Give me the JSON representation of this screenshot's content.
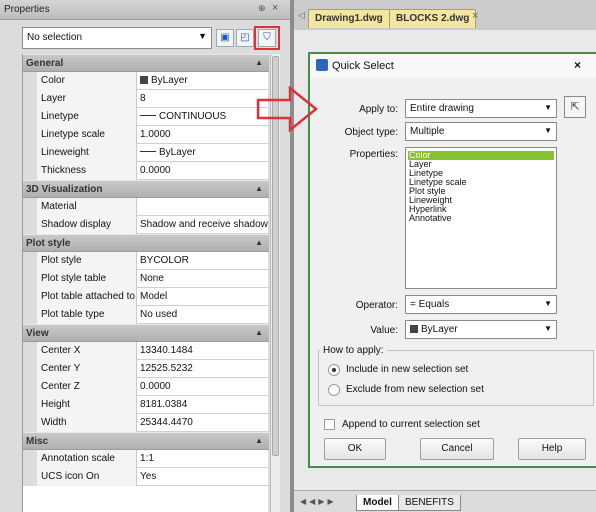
{
  "properties_palette": {
    "title": "Properties",
    "pin_glyph": "⊕",
    "close_glyph": "×",
    "selection": "No selection",
    "toolbar_icons": [
      "toggle-pickadd-icon",
      "select-objects-icon",
      "quick-select-icon"
    ],
    "categories": [
      {
        "name": "General",
        "rows": [
          {
            "name": "Color",
            "value": "ByLayer"
          },
          {
            "name": "Layer",
            "value": "8"
          },
          {
            "name": "Linetype",
            "value": "CONTINUOUS"
          },
          {
            "name": "Linetype scale",
            "value": "1.0000"
          },
          {
            "name": "Lineweight",
            "value": "ByLayer"
          },
          {
            "name": "Thickness",
            "value": "0.0000"
          }
        ]
      },
      {
        "name": "3D Visualization",
        "rows": [
          {
            "name": "Material",
            "value": ""
          },
          {
            "name": "Shadow display",
            "value": "Shadow and receive shadow"
          }
        ]
      },
      {
        "name": "Plot style",
        "rows": [
          {
            "name": "Plot style",
            "value": "BYCOLOR"
          },
          {
            "name": "Plot style table",
            "value": "None"
          },
          {
            "name": "Plot table attached to",
            "value": "Model"
          },
          {
            "name": "Plot table type",
            "value": "No used"
          }
        ]
      },
      {
        "name": "View",
        "rows": [
          {
            "name": "Center X",
            "value": "13340.1484"
          },
          {
            "name": "Center Y",
            "value": "12525.5232"
          },
          {
            "name": "Center Z",
            "value": "0.0000"
          },
          {
            "name": "Height",
            "value": "8181.0384"
          },
          {
            "name": "Width",
            "value": "25344.4470"
          }
        ]
      },
      {
        "name": "Misc",
        "rows": [
          {
            "name": "Annotation scale",
            "value": "1:1"
          },
          {
            "name": "UCS icon On",
            "value": "Yes"
          }
        ]
      }
    ]
  },
  "drawing": {
    "tabs": [
      "Drawing1.dwg",
      "BLOCKS 2.dwg"
    ],
    "tab_close": "×",
    "layout_tabs": [
      "Model",
      "BENEFITS"
    ]
  },
  "quick_select": {
    "title": "Quick Select",
    "close": "×",
    "apply_to_label": "Apply to:",
    "apply_to_value": "Entire drawing",
    "object_type_label": "Object type:",
    "object_type_value": "Multiple",
    "properties_label": "Properties:",
    "properties": [
      "Color",
      "Layer",
      "Linetype",
      "Linetype scale",
      "Plot style",
      "Lineweight",
      "Hyperlink",
      "Annotative"
    ],
    "selected_property": "Color",
    "operator_label": "Operator:",
    "operator_value": "= Equals",
    "value_label": "Value:",
    "value_value": "ByLayer",
    "how_to_apply_label": "How to apply:",
    "include_label": "Include in new selection set",
    "exclude_label": "Exclude from new selection set",
    "append_label": "Append to current selection set",
    "ok_label": "OK",
    "cancel_label": "Cancel",
    "help_label": "Help"
  },
  "colors": {
    "highlight_border": "#e0303a",
    "selected_property_bg": "#86c232",
    "doc_tab_bg": "#f3e6a0"
  }
}
